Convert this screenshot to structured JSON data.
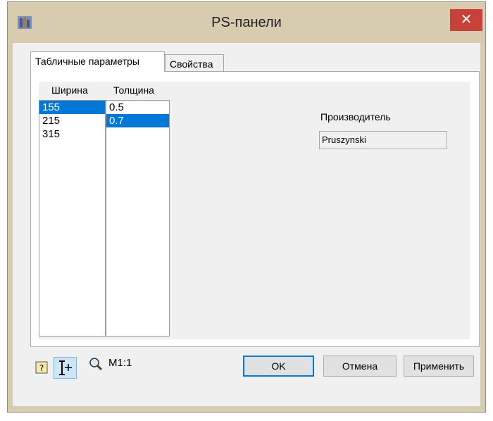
{
  "window": {
    "title": "PS-панели",
    "close": "✕"
  },
  "tabs": [
    {
      "label": "Табличные параметры",
      "active": true
    },
    {
      "label": "Свойства",
      "active": false
    }
  ],
  "width_list": {
    "header": "Ширина",
    "items": [
      "155",
      "215",
      "315"
    ],
    "selected": "155"
  },
  "thickness_list": {
    "header": "Толщина",
    "items": [
      "0.5",
      "0.7"
    ],
    "selected": "0.7"
  },
  "manufacturer": {
    "label": "Производитель",
    "value": "Pruszynski"
  },
  "toolbar": {
    "scale_label": "M1:1",
    "icons": [
      "help-icon",
      "dimension-tool-icon",
      "zoom-icon"
    ]
  },
  "buttons": {
    "ok": "OK",
    "cancel": "Отмена",
    "apply": "Применить"
  },
  "colors": {
    "selection": "#0078d7",
    "close": "#c7413a",
    "frame": "#d7cbb0"
  }
}
